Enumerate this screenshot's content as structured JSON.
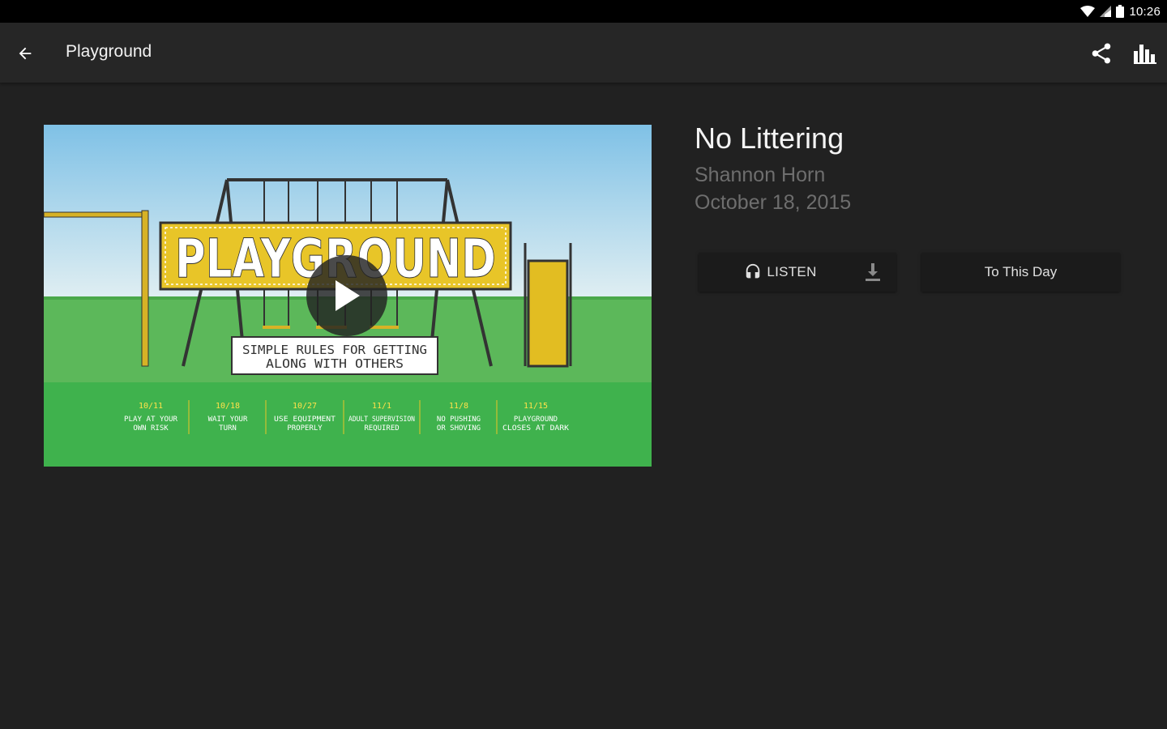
{
  "status_bar": {
    "time": "10:26",
    "icons": [
      "wifi-icon",
      "signal-icon",
      "battery-icon"
    ]
  },
  "app_bar": {
    "title": "Playground",
    "back_icon": "arrow-back-icon",
    "actions": [
      "share-icon",
      "bar-chart-icon"
    ]
  },
  "artwork": {
    "banner_title": "PLAYGROUND",
    "subtitle_line1": "SIMPLE RULES FOR GETTING",
    "subtitle_line2": "ALONG WITH OTHERS",
    "schedule": [
      {
        "date": "10/11",
        "line1": "PLAY AT YOUR",
        "line2": "OWN RISK"
      },
      {
        "date": "10/18",
        "line1": "WAIT YOUR",
        "line2": "TURN"
      },
      {
        "date": "10/27",
        "line1": "USE EQUIPMENT",
        "line2": "PROPERLY"
      },
      {
        "date": "11/1",
        "line1": "ADULT SUPERVISION",
        "line2": "REQUIRED"
      },
      {
        "date": "11/8",
        "line1": "NO PUSHING",
        "line2": "OR SHOVING"
      },
      {
        "date": "11/15",
        "line1": "PLAYGROUND",
        "line2": "CLOSES AT DARK"
      }
    ],
    "colors": {
      "sky": "#8cc8e8",
      "grass": "#5cb85a",
      "grass_dark": "#3fb24d",
      "sign": "#e8c528",
      "frame": "#3a3a3a",
      "slide": "#e2bd22"
    }
  },
  "sermon": {
    "title": "No Littering",
    "speaker": "Shannon Horn",
    "date": "October 18, 2015",
    "listen_label": "LISTEN",
    "listen_icon": "headphones-icon",
    "download_icon": "download-icon",
    "series_button_label": "To This Day",
    "play_icon": "play-icon"
  },
  "theme": {
    "background": "#212121",
    "app_bar": "#262626",
    "button_bg": "#1b1b1b",
    "muted_text": "#6e6e6e"
  }
}
